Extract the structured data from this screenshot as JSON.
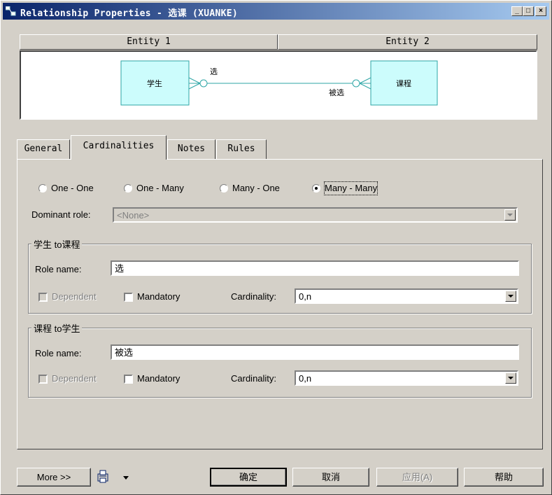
{
  "window": {
    "title": "Relationship Properties - 选课 (XUANKE)",
    "controls": {
      "minimize": "_",
      "maximize": "□",
      "close": "×"
    }
  },
  "entity_header": {
    "entity1": "Entity 1",
    "entity2": "Entity 2"
  },
  "diagram": {
    "entity1_name": "学生",
    "entity2_name": "课程",
    "role1": "选",
    "role2": "被选",
    "colors": {
      "entity_fill": "#ccfcfc",
      "entity_border": "#2ea6a6",
      "link": "#2ea6a6"
    }
  },
  "tabs": [
    {
      "label": "General"
    },
    {
      "label": "Cardinalities"
    },
    {
      "label": "Notes"
    },
    {
      "label": "Rules"
    }
  ],
  "cardinality_options": [
    {
      "label": "One - One",
      "selected": false
    },
    {
      "label": "One - Many",
      "selected": false
    },
    {
      "label": "Many - One",
      "selected": false
    },
    {
      "label": "Many - Many",
      "selected": true
    }
  ],
  "dominant_role": {
    "label": "Dominant role:",
    "value": "<None>"
  },
  "group1": {
    "title": "学生 to课程",
    "role_name_label": "Role name:",
    "role_name_value": "选",
    "dependent_label": "Dependent",
    "mandatory_label": "Mandatory",
    "cardinality_label": "Cardinality:",
    "cardinality_value": "0,n"
  },
  "group2": {
    "title": "课程 to学生",
    "role_name_label": "Role name:",
    "role_name_value": "被选",
    "dependent_label": "Dependent",
    "mandatory_label": "Mandatory",
    "cardinality_label": "Cardinality:",
    "cardinality_value": "0,n"
  },
  "footer": {
    "more_button": "More >>",
    "printer_icon": "printer-icon",
    "ok_button": "确定",
    "cancel_button": "取消",
    "apply_button": "应用(A)",
    "help_button": "帮助"
  }
}
